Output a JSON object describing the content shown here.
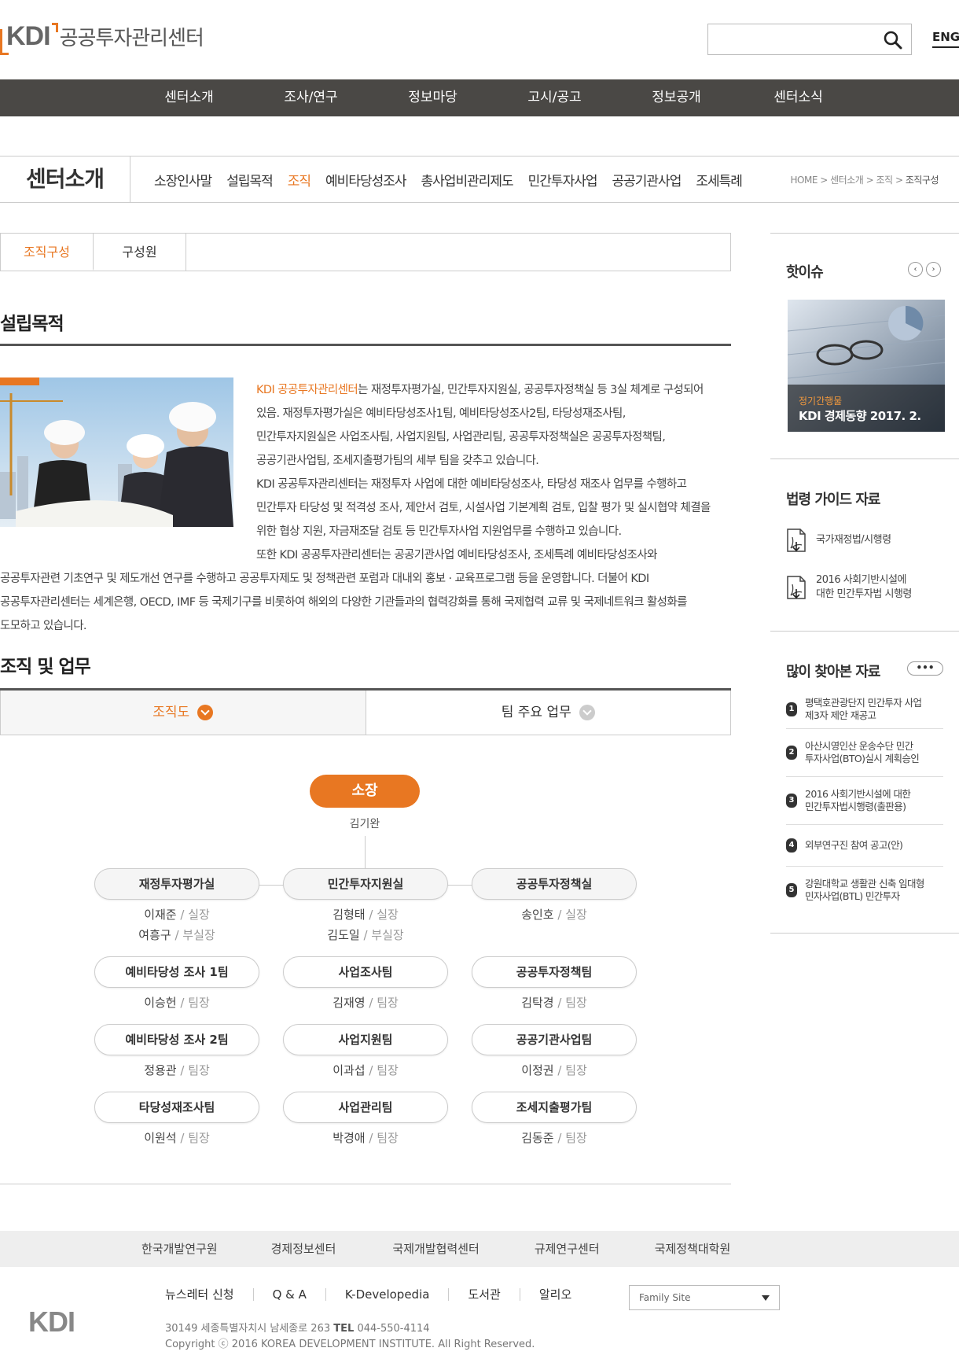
{
  "header": {
    "logo_mark": "KDI",
    "logo_text": "공공투자관리센터",
    "search_placeholder": "",
    "lang": "ENG"
  },
  "gnb": [
    "센터소개",
    "조사/연구",
    "정보마당",
    "고시/공고",
    "정보공개",
    "센터소식"
  ],
  "lnb": {
    "title": "센터소개",
    "menu": [
      "소장인사말",
      "설립목적",
      "조직",
      "예비타당성조사",
      "총사업비관리제도",
      "민간투자사업",
      "공공기관사업",
      "조세특례"
    ],
    "active_index": 2,
    "breadcrumb": [
      "HOME",
      ">",
      "센터소개",
      ">",
      "조직",
      ">",
      "조직구성"
    ]
  },
  "subtabs": [
    "조직구성",
    "구성원"
  ],
  "section1": {
    "title": "설립목적",
    "highlight": "KDI 공공투자관리센터",
    "lines": [
      "는 재정투자평가실, 민간투자지원실, 공공투자정책실 등 3실 체계로 구성되어",
      "있음. 재정투자평가실은 예비타당성조사1팀, 예비타당성조사2팀, 타당성재조사팀,",
      "민간투자지원실은 사업조사팀, 사업지원팀, 사업관리팀, 공공투자정책실은 공공투자정책팀,",
      "공공기관사업팀, 조세지출평가팀의 세부 팀을 갖추고 있습니다.",
      "KDI 공공투자관리센터는 재정투자 사업에 대한 예비타당성조사, 타당성 재조사 업무를 수행하고",
      "민간투자 타당성 및 적격성 조사, 제안서 검토, 시설사업 기본계획 검토, 입찰 평가 및 실시협약 체결을",
      "위한 협상 지원, 자금재조달 검토 등 민간투자사업 지원업무를 수행하고 있습니다.",
      "또한 KDI 공공투자관리센터는 공공기관사업 예비타당성조사, 조세특례 예비타당성조사와"
    ],
    "full_lines": [
      "공공투자관련 기초연구 및 제도개선 연구를 수행하고 공공투자제도 및 정책관련 포럼과 대내외 홍보 · 교육프로그램 등을 운영합니다. 더불어 KDI",
      "공공투자관리센터는 세계은행, OECD, IMF 등 국제기구를 비롯하여 해외의 다양한 기관들과의 협력강화를 통해 국제협력 교류 및 국제네트워크 활성화를",
      "도모하고 있습니다."
    ]
  },
  "section2": {
    "title": "조직 및 업무",
    "tabs": [
      "조직도",
      "팀 주요 업무"
    ]
  },
  "org": {
    "head": {
      "title": "소장",
      "name": "김기완"
    },
    "columns": [
      {
        "office": "재정투자평가실",
        "office_people": [
          {
            "name": "이재준",
            "role": "실장"
          },
          {
            "name": "여흥구",
            "role": "부실장"
          }
        ],
        "teams": [
          {
            "team": "예비타당성 조사 1팀",
            "name": "이승헌",
            "role": "팀장"
          },
          {
            "team": "예비타당성 조사 2팀",
            "name": "정용관",
            "role": "팀장"
          },
          {
            "team": "타당성재조사팀",
            "name": "이원석",
            "role": "팀장"
          }
        ]
      },
      {
        "office": "민간투자지원실",
        "office_people": [
          {
            "name": "김형태",
            "role": "실장"
          },
          {
            "name": "김도일",
            "role": "부실장"
          }
        ],
        "teams": [
          {
            "team": "사업조사팀",
            "name": "김재영",
            "role": "팀장"
          },
          {
            "team": "사업지원팀",
            "name": "이과섭",
            "role": "팀장"
          },
          {
            "team": "사업관리팀",
            "name": "박경애",
            "role": "팀장"
          }
        ]
      },
      {
        "office": "공공투자정책실",
        "office_people": [
          {
            "name": "송인호",
            "role": "실장"
          }
        ],
        "teams": [
          {
            "team": "공공투자정책팀",
            "name": "김탁경",
            "role": "팀장"
          },
          {
            "team": "공공기관사업팀",
            "name": "이정권",
            "role": "팀장"
          },
          {
            "team": "조세지출평가팀",
            "name": "김동준",
            "role": "팀장"
          }
        ]
      }
    ]
  },
  "sidebar": {
    "hot": {
      "title": "핫이슈",
      "prev": "‹",
      "next": "›",
      "category": "정기간행물",
      "headline": "KDI 경제동향 2017. 2."
    },
    "law": {
      "title": "법령 가이드 자료",
      "docs": [
        [
          "국가재정법/시행령"
        ],
        [
          "2016 사회기반시설에",
          "대한 민간투자법 시행령"
        ]
      ]
    },
    "popular": {
      "title": "많이 찾아본 자료",
      "more": "•••",
      "items": [
        [
          "평택호관광단지 민간투자 사업",
          "제3자 제안 재공고"
        ],
        [
          "아산시영인산 운송수단 민간",
          "투자사업(BTO)실시 계획승인"
        ],
        [
          "2016 사회기반시설에 대한",
          "민간투자법시행령(출판용)"
        ],
        [
          "외부연구진 참여 공고(안)"
        ],
        [
          "강원대학교 생활관 신축 임대형",
          "민자사업(BTL) 민간투자"
        ]
      ]
    }
  },
  "footer": {
    "bar": [
      "한국개발연구원",
      "경제정보센터",
      "국제개발협력센터",
      "규제연구센터",
      "국제정책대학원"
    ],
    "links": [
      "뉴스레터 신청",
      "Q & A",
      "K-Developedia",
      "도서관",
      "알리오"
    ],
    "family": "Family Site",
    "address_pre": "30149 세종특별자치시 남세종로 263 ",
    "tel_label": "TEL",
    "tel": " 044-550-4114",
    "copyright": "Copyright ⓒ 2016 KOREA DEVELOPMENT INSTITUTE. All Right Reserved.",
    "logo": "KDI"
  }
}
